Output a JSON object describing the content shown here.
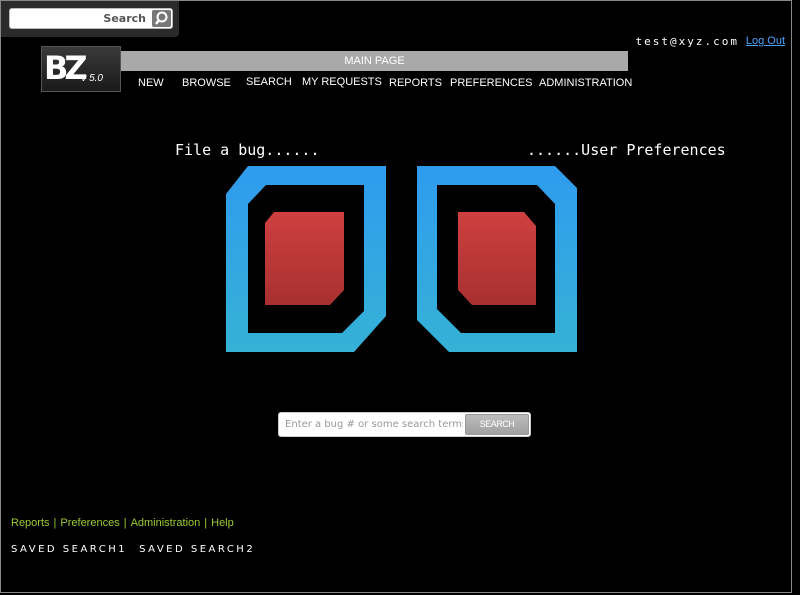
{
  "search": {
    "label": "Search",
    "icon": "magnifier-icon"
  },
  "user": {
    "email": "test@xyz.com",
    "logout": "Log Out"
  },
  "logo": {
    "letters": "BZ",
    "version": "v 5.0"
  },
  "header": {
    "title": "MAIN PAGE"
  },
  "nav": {
    "items": [
      "NEW",
      "BROWSE",
      "SEARCH",
      "MY REQUESTS",
      "REPORTS",
      "PREFERENCES",
      "ADMINISTRATION"
    ]
  },
  "sections": {
    "file_bug": "File a bug......",
    "user_prefs": "......User Preferences"
  },
  "colors": {
    "card_frame": "#3399ee",
    "card_inner": "#c03a3a",
    "footer_link": "#9acd32",
    "logout": "#4ca3ff"
  },
  "bug_search": {
    "placeholder": "Enter a bug # or some search terms",
    "button": "SEARCH"
  },
  "footer": {
    "links": [
      "Reports",
      "Preferences",
      "Administration",
      "Help"
    ]
  },
  "saved_searches": [
    "SAVED SEARCH1",
    "SAVED SEARCH2"
  ]
}
